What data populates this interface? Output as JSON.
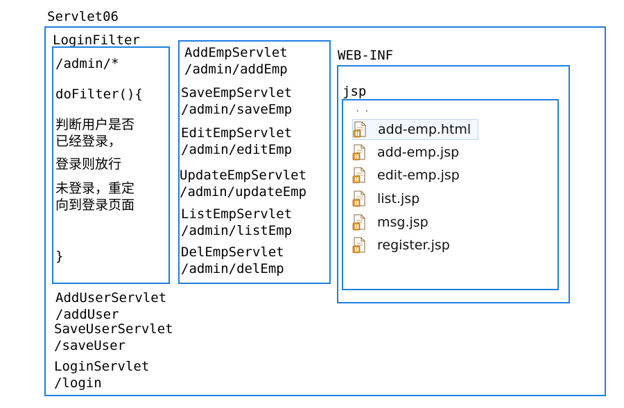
{
  "project": {
    "title": "Servlet06"
  },
  "filter": {
    "name": "LoginFilter",
    "mapping": "/admin/*",
    "method": "doFilter(){",
    "desc1_line1": "判断用户是否",
    "desc1_line2": "已经登录，",
    "desc2": "登录则放行",
    "desc3_line1": "未登录，重定",
    "desc3_line2": "向到登录页面",
    "closing": "}"
  },
  "admin_servlets": [
    {
      "name": "AddEmpServlet",
      "path": "/admin/addEmp"
    },
    {
      "name": "SaveEmpServlet",
      "path": "/admin/saveEmp"
    },
    {
      "name": "EditEmpServlet",
      "path": "/admin/editEmp"
    },
    {
      "name": "UpdateEmpServlet",
      "path": "/admin/updateEmp"
    },
    {
      "name": "ListEmpServlet",
      "path": "/admin/listEmp"
    },
    {
      "name": "DelEmpServlet",
      "path": "/admin/delEmp"
    }
  ],
  "public_servlets": [
    {
      "name": "AddUserServlet",
      "path": "/addUser"
    },
    {
      "name": "SaveUserServlet",
      "path": "/saveUser"
    },
    {
      "name": "LoginServlet",
      "path": "/login"
    }
  ],
  "webinf": {
    "label": "WEB-INF",
    "folder": "jsp",
    "files": [
      {
        "name": "add-emp.html",
        "icon": "html-file-icon",
        "selected": true
      },
      {
        "name": "add-emp.jsp",
        "icon": "jsp-file-icon",
        "selected": false
      },
      {
        "name": "edit-emp.jsp",
        "icon": "jsp-file-icon",
        "selected": false
      },
      {
        "name": "list.jsp",
        "icon": "jsp-file-icon",
        "selected": false
      },
      {
        "name": "msg.jsp",
        "icon": "jsp-file-icon",
        "selected": false
      },
      {
        "name": "register.jsp",
        "icon": "jsp-file-icon",
        "selected": false
      }
    ]
  },
  "colors": {
    "border": "#1c7fe0",
    "icon_orange": "#e39b27",
    "icon_page": "#ffffff"
  }
}
